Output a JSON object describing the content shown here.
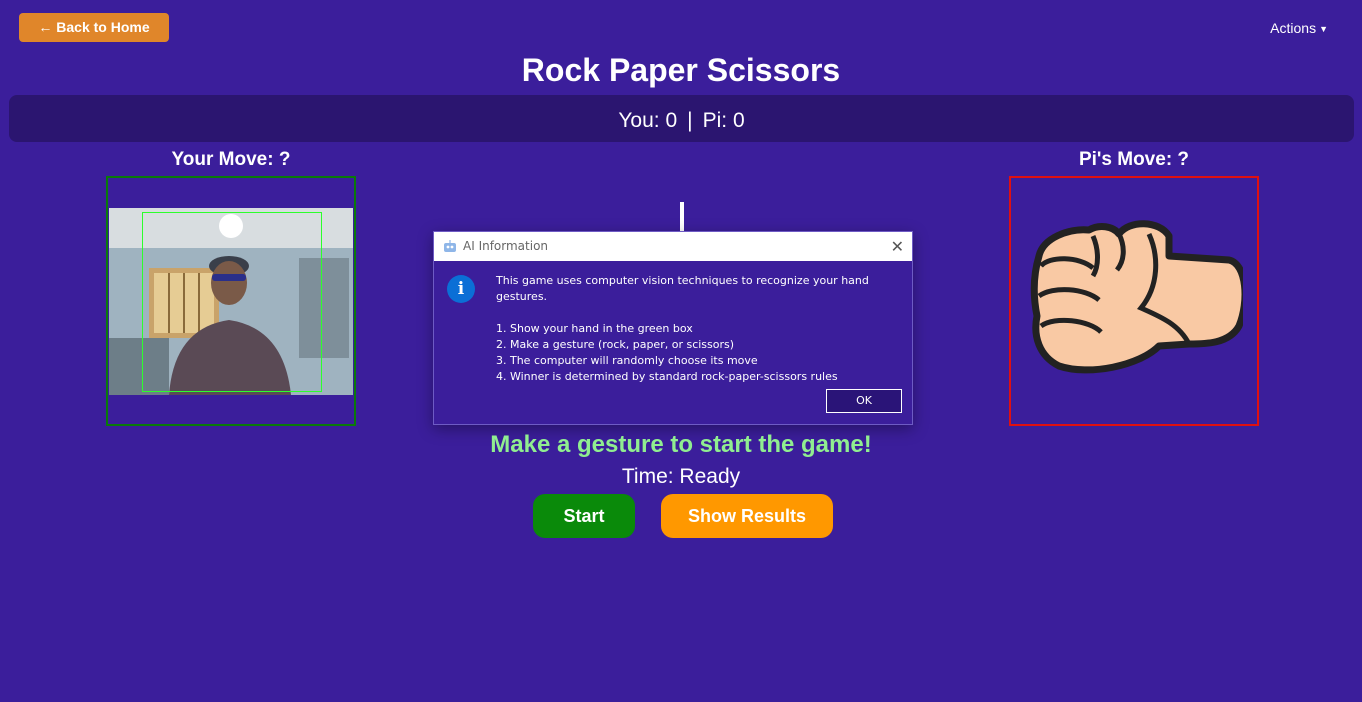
{
  "header": {
    "back_label": "← Back to Home",
    "actions_label": "Actions",
    "title": "Rock Paper Scissors"
  },
  "score": {
    "you_label": "You: 0",
    "separator": "|",
    "pi_label": "Pi: 0"
  },
  "moves": {
    "your_move": "Your Move: ?",
    "pi_move": "Pi's Move: ?",
    "pi_move_icon": "rock-fist-icon"
  },
  "dialog": {
    "title": "AI Information",
    "intro": "This game uses computer vision techniques to recognize your hand gestures.",
    "steps": [
      "1. Show your hand in the green box",
      "2. Make a gesture (rock, paper, or scissors)",
      "3. The computer will randomly choose its move",
      "4. Winner is determined by standard rock-paper-scissors rules"
    ],
    "ok_label": "OK"
  },
  "game": {
    "status": "Make a gesture to start the game!",
    "timer": "Time: Ready",
    "start_label": "Start",
    "results_label": "Show Results"
  },
  "colors": {
    "background": "#3b1e9b",
    "score_bar": "#2b1570",
    "back_button": "#e0862a",
    "start_button": "#0a8a0a",
    "results_button": "#ff9800",
    "status_text": "#90ee90",
    "player_border": "#0a7a0a",
    "pi_border": "#e01010"
  }
}
